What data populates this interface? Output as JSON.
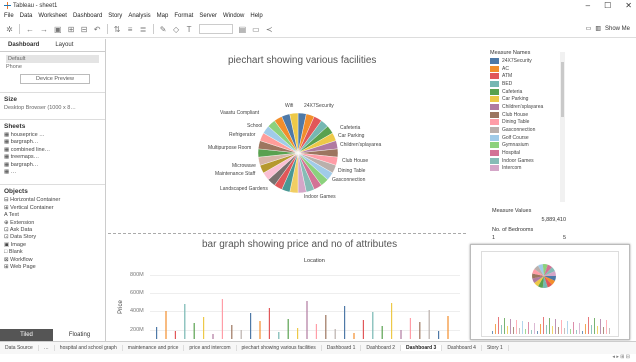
{
  "window": {
    "title": "Tableau - sheet1",
    "controls": [
      "–",
      "☐",
      "✕"
    ]
  },
  "menu": [
    "File",
    "Data",
    "Worksheet",
    "Dashboard",
    "Story",
    "Analysis",
    "Map",
    "Format",
    "Server",
    "Window",
    "Help"
  ],
  "toolbar": {
    "showme_label": "Show Me"
  },
  "left_panel": {
    "tabs": [
      "Dashboard",
      "Layout"
    ],
    "devices": [
      "Default",
      "Phone"
    ],
    "device_preview": "Device Preview",
    "size_header": "Size",
    "size_value": "Desktop Browser (1000 x 8…",
    "sheets_header": "Sheets",
    "sheets": [
      "houseprice …",
      "bargraph…",
      "combined line…",
      "treemaps…",
      "bargraph…",
      "…"
    ],
    "objects_header": "Objects",
    "objects": [
      "Horizontal Container",
      "Vertical Container",
      "Text",
      "Extension",
      "Ask Data",
      "Data Story",
      "Image",
      "Blank",
      "Workflow",
      "Web Page"
    ],
    "tiled": "Tiled",
    "floating": "Floating"
  },
  "pie": {
    "title": "piechart showing various facilities",
    "labels": [
      "Wifi",
      "24X7Security",
      "Vaastu Compliant",
      "School",
      "Refrigerator",
      "Multipurpose Room",
      "Microwave",
      "Maintenance Staff",
      "Landscaped Gardens",
      "Cafeteria",
      "Car Parking",
      "Children'splayarea",
      "Club House",
      "Dining Table",
      "Gasconnection",
      "Indoor Games"
    ]
  },
  "legend": {
    "header": "Measure Names",
    "items": [
      {
        "label": "24X7Security",
        "color": "#4e79a7"
      },
      {
        "label": "AC",
        "color": "#f28e2b"
      },
      {
        "label": "ATM",
        "color": "#e15759"
      },
      {
        "label": "BED",
        "color": "#76b7b2"
      },
      {
        "label": "Cafeteria",
        "color": "#59a14f"
      },
      {
        "label": "Car Parking",
        "color": "#edc948"
      },
      {
        "label": "Children'splayarea",
        "color": "#b07aa1"
      },
      {
        "label": "Club House",
        "color": "#9c755f"
      },
      {
        "label": "Dining Table",
        "color": "#ff9da7"
      },
      {
        "label": "Gasconnection",
        "color": "#bab0ac"
      },
      {
        "label": "Golf Course",
        "color": "#a0cbe8"
      },
      {
        "label": "Gymnasium",
        "color": "#8cd17d"
      },
      {
        "label": "Hospital",
        "color": "#d37295"
      },
      {
        "label": "Indoor Games",
        "color": "#86bcb6"
      },
      {
        "label": "Intercom",
        "color": "#d4a6c8"
      }
    ]
  },
  "measure_values": {
    "header": "Measure Values",
    "value": "5,889,410"
  },
  "bedrooms": {
    "header": "No. of Bedrooms",
    "min": "1",
    "max": "5"
  },
  "bar": {
    "title": "bar graph showing price and no of attributes",
    "location_label": "Location",
    "ylabel": "Price",
    "ticks": [
      "800M",
      "600M",
      "400M",
      "200M"
    ]
  },
  "bottom_tabs": [
    "Data Source",
    "…",
    "hospital and school graph",
    "maintenance and price",
    "price and intercom",
    "piechart showing various facilities",
    "Dashboard 1",
    "Dashboard 2",
    "Dashboard 3",
    "Dashboard 4",
    "Story 1"
  ],
  "active_tab_index": 8
}
